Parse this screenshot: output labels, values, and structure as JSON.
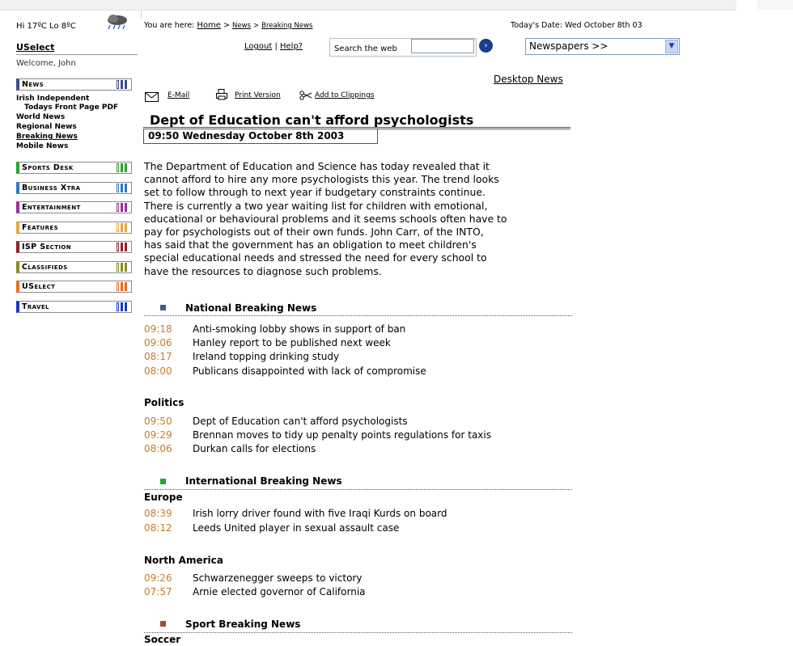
{
  "weather": {
    "text": "Hi 17ºC Lo 8ºC"
  },
  "breadcrumb": {
    "prefix": "You are here:",
    "home": "Home",
    "news": "News",
    "breaking": "Breaking News",
    "sep": ">"
  },
  "today": "Today's Date: Wed October 8th 03",
  "uselect": "USelect",
  "welcome": "Welcome, John",
  "account": {
    "logout": "Logout",
    "sep": "|",
    "help": "Help?"
  },
  "search": {
    "label": "Search the web",
    "value": "",
    "go": "›"
  },
  "newspapers": {
    "selected": "Newspapers >>"
  },
  "sidebar": {
    "news": "News",
    "sub_items": [
      "Irish Independent",
      "Todays Front Page PDF",
      "World News",
      "Regional News",
      "Breaking News",
      "Mobile News"
    ],
    "sections": [
      {
        "label": "Sports Desk",
        "color": "#2aa52a"
      },
      {
        "label": "Business Xtra",
        "color": "#2f78c8"
      },
      {
        "label": "Entertainment",
        "color": "#9b2f9b"
      },
      {
        "label": "Features",
        "color": "#e7a83c"
      },
      {
        "label": "ISP Section",
        "color": "#8a2525"
      },
      {
        "label": "Classifieds",
        "color": "#8a8a25"
      },
      {
        "label": "USelect",
        "color": "#ee6a1a"
      },
      {
        "label": "Travel",
        "color": "#1d37c8"
      }
    ],
    "news_color": "#3c4f8c"
  },
  "desktop_news": "Desktop News",
  "tools": {
    "email": "E-Mail",
    "print": "Print Version",
    "clip": "Add to Clippings"
  },
  "article": {
    "headline": "Dept of Education can't afford psychologists",
    "time": "09:50 Wednesday October 8th 2003",
    "lines": [
      "The Department of Education and Science has today revealed that it",
      "cannot afford to hire any more psychologists this year. The trend looks",
      "set to follow through to next year if budgetary constraints continue.",
      "There is currently a two year waiting list for children with emotional,",
      "educational or behavioural problems and it seems schools often have to",
      "pay for psychologists out of their own funds. John Carr, of the INTO,",
      "has said that the government has an obligation to meet children's",
      "special educational needs and stressed the need for every school to",
      "have the resources to diagnose such problems."
    ]
  },
  "sections": {
    "national": {
      "title": "National Breaking News",
      "color": "#4a5a8c",
      "items": [
        {
          "time": "09:18",
          "text": "Anti-smoking lobby shows in support of ban"
        },
        {
          "time": "09:06",
          "text": "Hanley report to be published next week"
        },
        {
          "time": "08:17",
          "text": "Ireland topping drinking study"
        },
        {
          "time": "08:00",
          "text": "Publicans disappointed with lack of compromise"
        }
      ]
    },
    "politics": {
      "title": "Politics",
      "items": [
        {
          "time": "09:50",
          "text": "Dept of Education can't afford psychologists"
        },
        {
          "time": "09:29",
          "text": "Brennan moves to tidy up penalty points regulations for taxis"
        },
        {
          "time": "08:06",
          "text": "Durkan calls for elections"
        }
      ]
    },
    "international": {
      "title": "International Breaking News",
      "color": "#22aa22",
      "europe": {
        "title": "Europe",
        "items": [
          {
            "time": "08:39",
            "text": "Irish lorry driver found with five Iraqi Kurds on board"
          },
          {
            "time": "08:12",
            "text": "Leeds United player in sexual assault case"
          }
        ]
      },
      "north_america": {
        "title": "North America",
        "items": [
          {
            "time": "09:26",
            "text": "Schwarzenegger sweeps to victory"
          },
          {
            "time": "07:57",
            "text": "Arnie elected governor of California"
          }
        ]
      }
    },
    "sport": {
      "title": "Sport Breaking News",
      "color": "#a84a3a",
      "soccer": "Soccer"
    }
  }
}
